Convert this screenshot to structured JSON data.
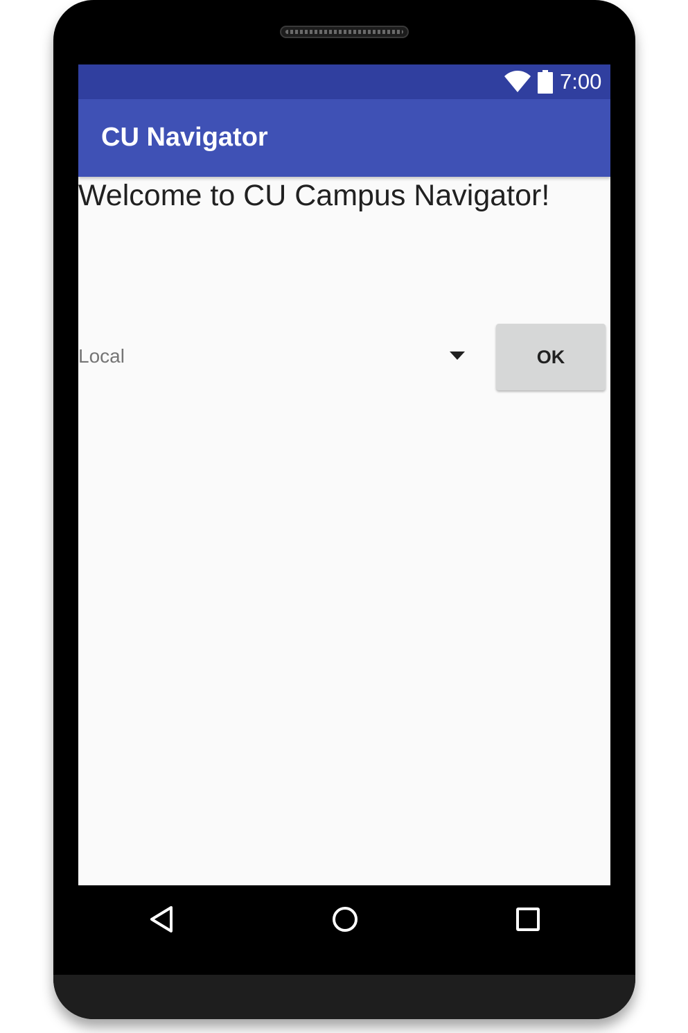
{
  "status_bar": {
    "time": "7:00",
    "icons": [
      "wifi-icon",
      "battery-icon"
    ]
  },
  "app_bar": {
    "title": "CU Navigator"
  },
  "main": {
    "welcome_text": "Welcome to CU Campus Navigator!",
    "spinner": {
      "selected_value": "Local"
    },
    "ok_button_label": "OK"
  },
  "navigation_bar": {
    "icons": [
      "back-icon",
      "home-icon",
      "recents-icon"
    ]
  },
  "colors": {
    "status_bar": "#303f9f",
    "app_bar": "#3f51b5",
    "background": "#fafafa",
    "button": "#d6d7d7"
  }
}
